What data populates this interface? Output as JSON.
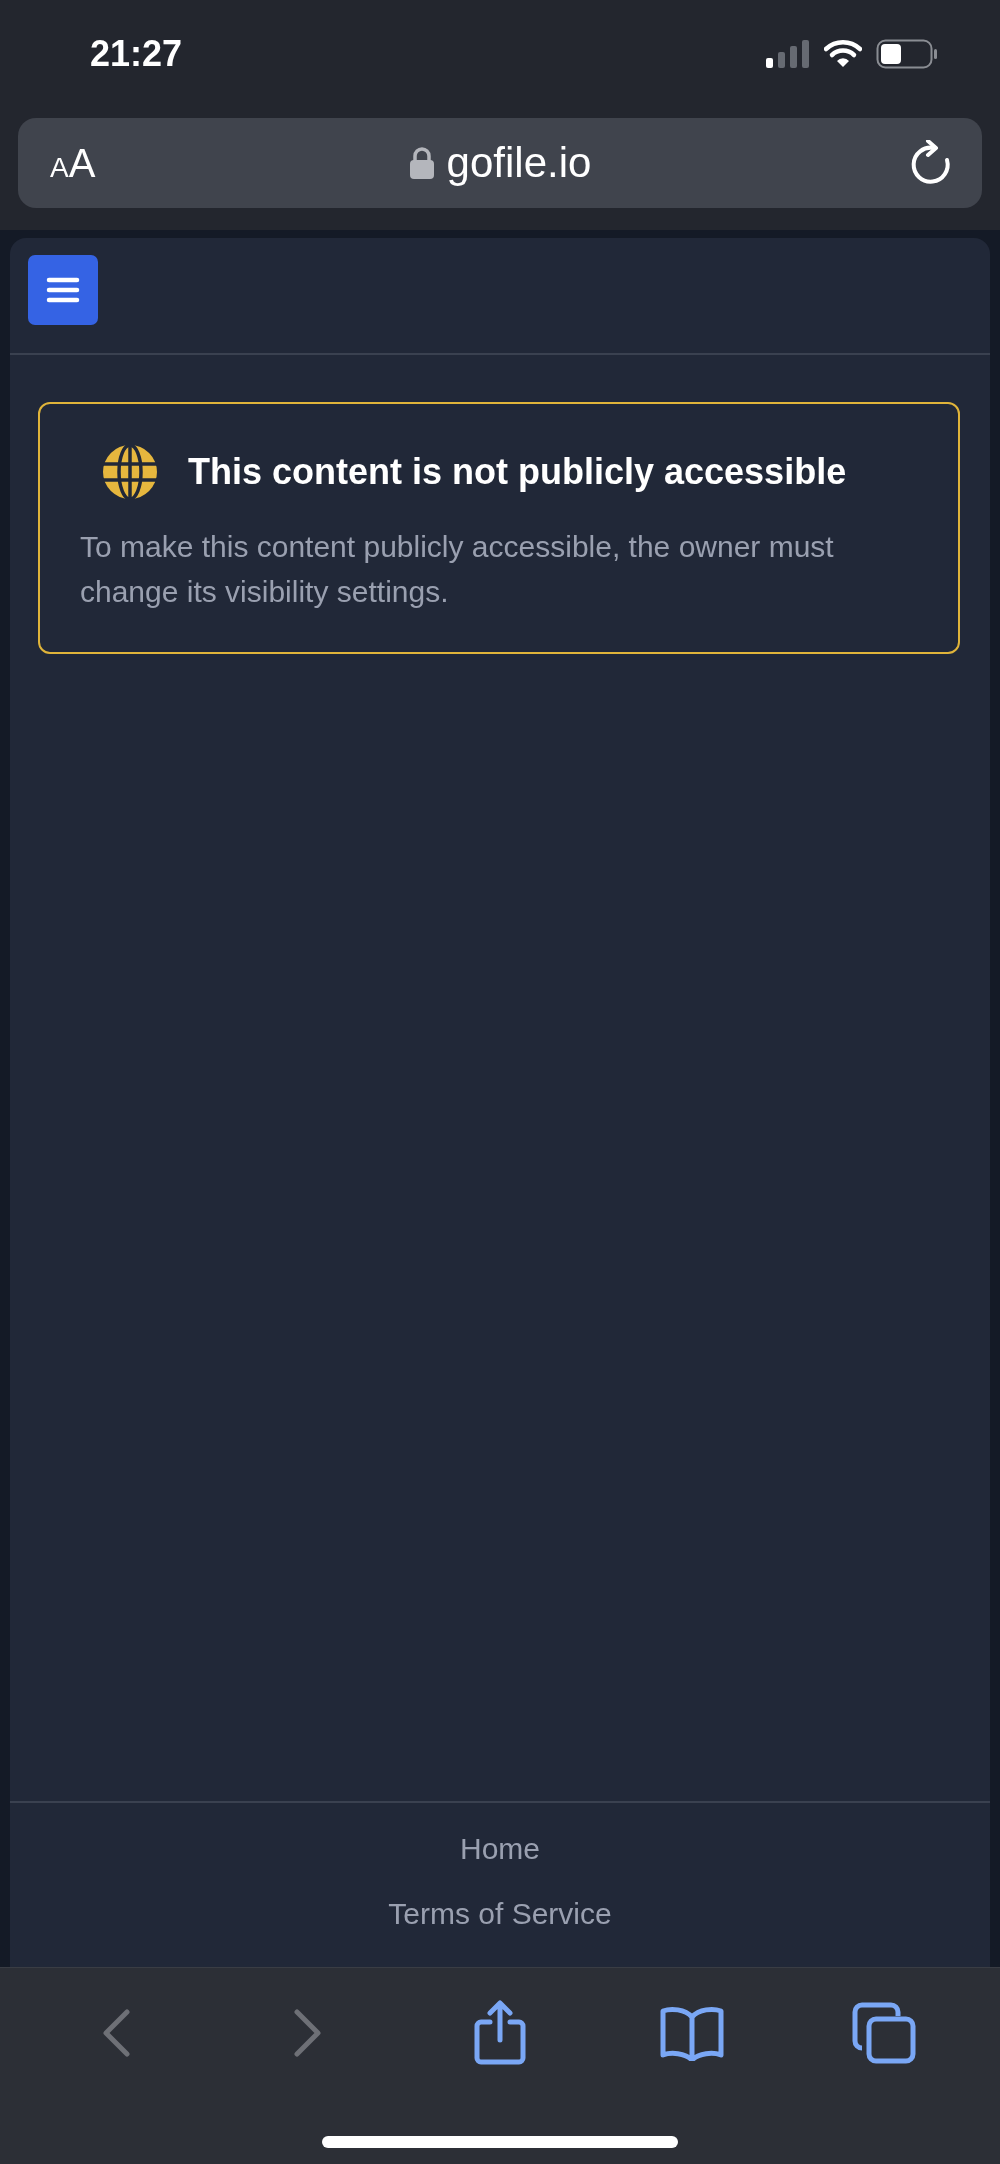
{
  "status_bar": {
    "time": "21:27"
  },
  "address_bar": {
    "text_size_button": "AA",
    "url": "gofile.io",
    "secure": true
  },
  "notice": {
    "title": "This content is not publicly accessible",
    "message": "To make this content publicly accessible, the owner must change its visibility settings."
  },
  "footer_links": [
    "Home",
    "Terms of Service"
  ],
  "toolbar": [
    {
      "kind": "back",
      "disabled": true
    },
    {
      "kind": "forward",
      "disabled": true
    },
    {
      "kind": "share",
      "disabled": false
    },
    {
      "kind": "bookmarks",
      "disabled": false
    },
    {
      "kind": "tabs",
      "disabled": false
    }
  ]
}
